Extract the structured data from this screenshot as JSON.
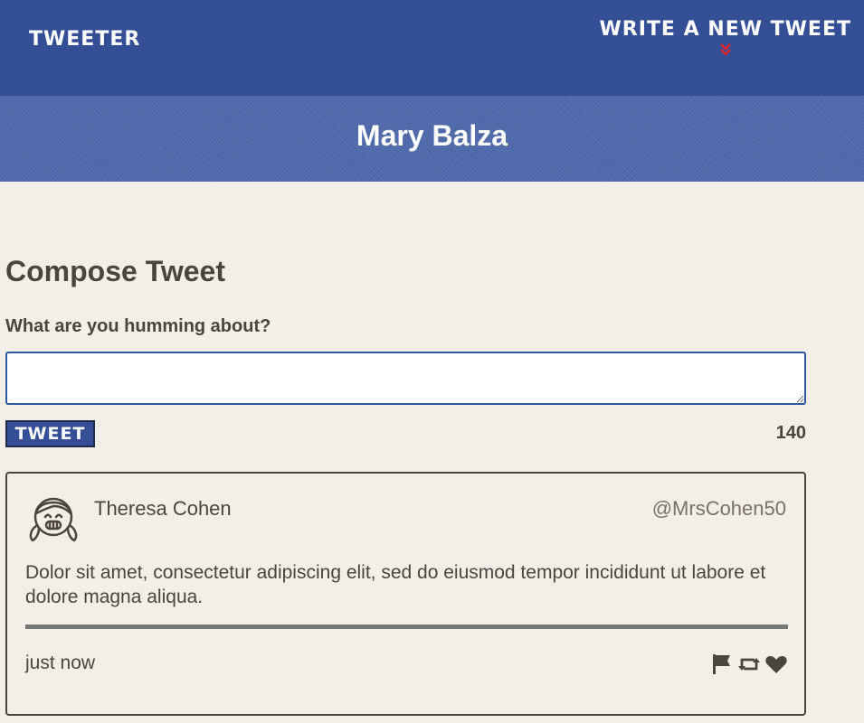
{
  "nav": {
    "brand": "Tweeter",
    "write_link": "Write a new tweet",
    "accent_color": "#e0252e",
    "bar_color": "#344f96"
  },
  "profile": {
    "name": "Mary Balza"
  },
  "compose": {
    "title": "Compose Tweet",
    "prompt": "What are you humming about?",
    "input_value": "",
    "button_label": "Tweet",
    "counter": "140"
  },
  "tweets": [
    {
      "name": "Theresa Cohen",
      "handle": "@MrsCohen50",
      "text": "Dolor sit amet, consectetur adipiscing elit, sed do eiusmod tempor incididunt ut labore et dolore magna aliqua.",
      "time": "just now",
      "avatar_icon": "girl-avatar-icon",
      "actions": [
        "flag-icon",
        "retweet-icon",
        "heart-icon"
      ]
    }
  ]
}
